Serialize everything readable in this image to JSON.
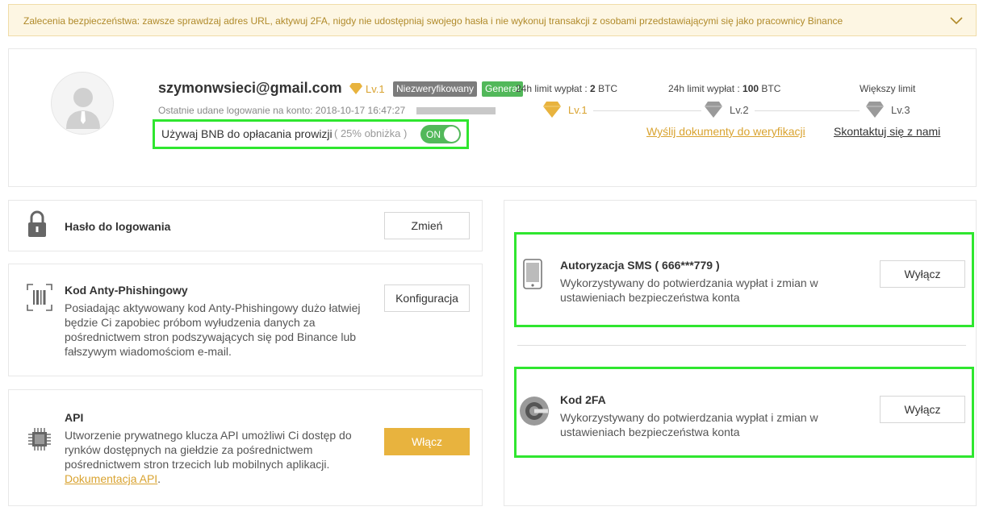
{
  "notice": {
    "text": "Zalecenia bezpieczeństwa: zawsze sprawdzaj adres URL, aktywuj 2FA, nigdy nie udostępniaj swojego hasła i nie wykonuj transakcji z osobami przedstawiającymi się jako pracownicy Binance"
  },
  "profile": {
    "email": "szymonwsieci@gmail.com",
    "level": "Lv.1",
    "badge_unverified": "Niezweryfikowany",
    "badge_general": "General",
    "last_login": "Ostatnie udane logowanie na konto: 2018-10-17 16:47:27",
    "bnb_label": "Używaj BNB do opłacania prowizji",
    "bnb_discount": "( 25% obniżka )",
    "bnb_toggle": "ON"
  },
  "limits": {
    "l1_prefix": "24h limit wypłat : ",
    "l1_value": "2",
    "l1_unit": " BTC",
    "l2_prefix": "24h limit wypłat : ",
    "l2_value": "100",
    "l2_unit": " BTC",
    "l3": "Większy limit",
    "lv1": "Lv.1",
    "lv2": "Lv.2",
    "lv3": "Lv.3",
    "send_docs": "Wyślij dokumenty do weryfikacji",
    "contact": "Skontaktuj się z nami"
  },
  "security": {
    "password_title": "Hasło do logowania",
    "password_button": "Zmień",
    "antiphishing_title": "Kod Anty-Phishingowy",
    "antiphishing_desc": [
      "Posiadając aktywowany kod Anty-Phishingowy dużo łatwiej",
      "będzie Ci zapobiec próbom wyłudzenia danych za",
      "pośrednictwem stron podszywających się pod Binance lub",
      "fałszywym wiadomościom e-mail."
    ],
    "antiphishing_button": "Konfiguracja",
    "api_title": "API",
    "api_desc": [
      "Utworzenie prywatnego klucza API umożliwi Ci dostęp do",
      "rynków dostępnych na giełdzie za pośrednictwem",
      "pośrednictwem stron trzecich lub mobilnych aplikacji."
    ],
    "api_link": "Dokumentacja API",
    "api_period": ".",
    "api_button": "Włącz",
    "sms_title": "Autoryzacja SMS ( 666***779 )",
    "sms_desc": [
      "Wykorzystywany do potwierdzania wypłat i zmian w",
      "ustawieniach bezpieczeństwa konta"
    ],
    "sms_button": "Wyłącz",
    "tfa_title": "Kod 2FA",
    "tfa_desc": [
      "Wykorzystywany do potwierdzania wypłat i zmian w",
      "ustawieniach bezpieczeństwa konta"
    ],
    "tfa_button": "Wyłącz"
  },
  "colors": {
    "accent_gold": "#e8b33e",
    "highlight_green": "#2fe62f",
    "toggle_green": "#52b85a",
    "badge_grey": "#7c7c7c"
  },
  "icons": [
    "chevron-down-icon",
    "user-avatar-icon",
    "diamond-icon",
    "lock-icon",
    "barcode-icon",
    "chip-icon",
    "phone-icon",
    "google-authenticator-icon"
  ]
}
